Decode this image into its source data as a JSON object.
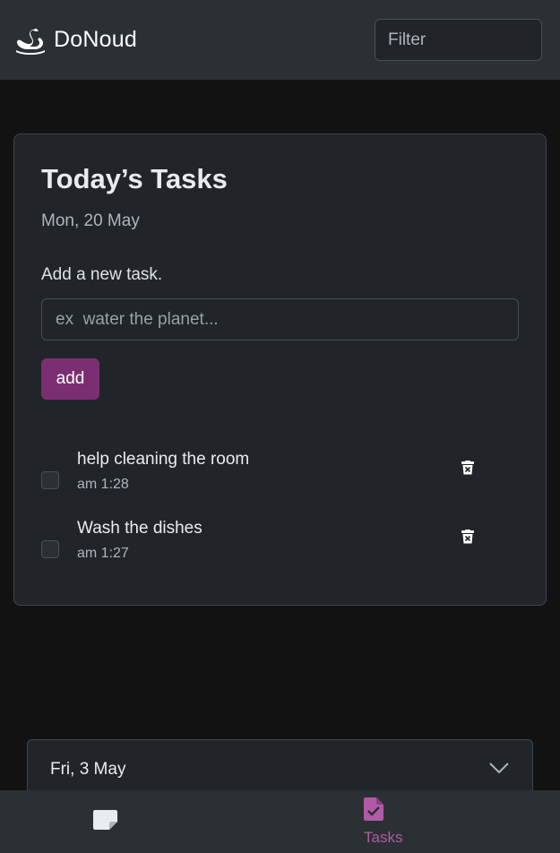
{
  "app": {
    "name": "DoNoud"
  },
  "filter": {
    "placeholder": "Filter"
  },
  "today": {
    "title": "Today’s Tasks",
    "date": "Mon, 20 May",
    "add_label": "Add a new task.",
    "input_placeholder": "ex  water the planet...",
    "add_button": "add",
    "tasks": [
      {
        "title": "help cleaning the room",
        "time": "am 1:28",
        "done": false
      },
      {
        "title": "Wash the dishes",
        "time": "am 1:27",
        "done": false
      }
    ]
  },
  "past": [
    {
      "label": "Fri, 3 May",
      "icon": "chevron-down-icon"
    }
  ],
  "bottom_nav": {
    "items": [
      {
        "icon": "note-icon",
        "label": ""
      },
      {
        "icon": "task-file-icon",
        "label": "Tasks",
        "active": true
      }
    ]
  },
  "colors": {
    "accent": "#7b2f72",
    "accent_text": "#b05aa6",
    "surface": "#212529",
    "bar": "#2b3035",
    "background": "#121212"
  }
}
